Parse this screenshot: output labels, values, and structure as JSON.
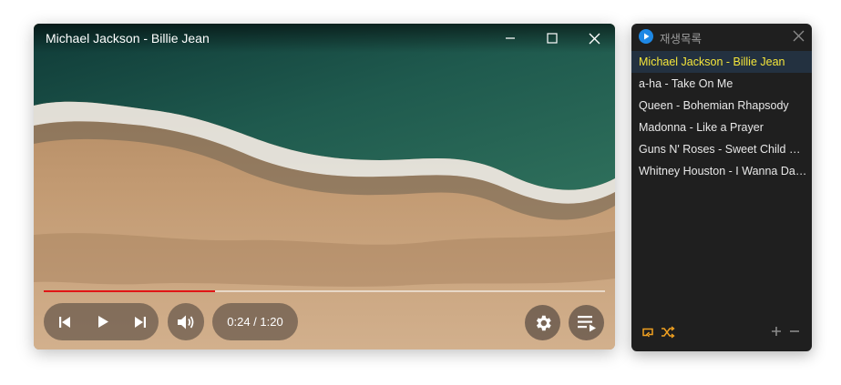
{
  "player": {
    "title": "Michael Jackson - Billie Jean",
    "progress_fraction": 0.305,
    "time_text": "0:24 / 1:20",
    "accent_color": "#e01616",
    "icons": [
      "minimize-icon",
      "maximize-icon",
      "close-icon",
      "skip-previous-icon",
      "play-icon",
      "skip-next-icon",
      "volume-icon",
      "settings-icon",
      "playlist-icon"
    ]
  },
  "playlist": {
    "title": "재생목록",
    "active_color": "#f5e63a",
    "items": [
      {
        "label": "Michael Jackson - Billie Jean"
      },
      {
        "label": "a-ha - Take On Me"
      },
      {
        "label": "Queen - Bohemian Rhapsody"
      },
      {
        "label": "Madonna - Like a Prayer"
      },
      {
        "label": "Guns N' Roses - Sweet Child O' Mine"
      },
      {
        "label": "Whitney Houston - I Wanna Dance with Somebody"
      }
    ],
    "icons": [
      "app-logo-icon",
      "close-icon",
      "repeat-icon",
      "shuffle-icon",
      "add-icon",
      "remove-icon"
    ]
  }
}
